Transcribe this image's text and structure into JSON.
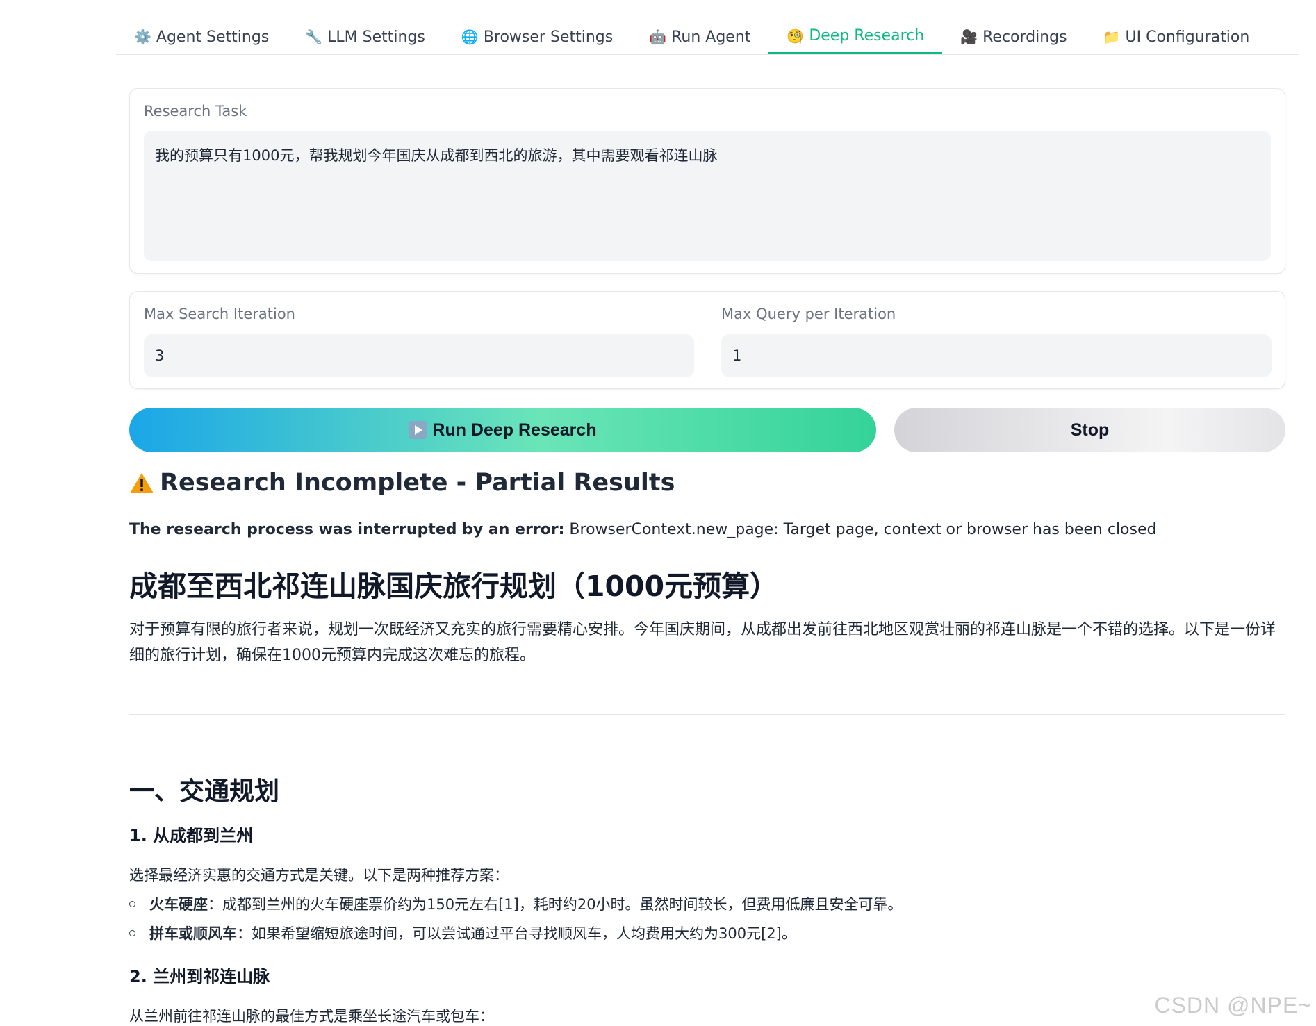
{
  "tabs": [
    {
      "icon": "⚙️",
      "label": "Agent Settings"
    },
    {
      "icon": "🔧",
      "label": "LLM Settings"
    },
    {
      "icon": "🌐",
      "label": "Browser Settings"
    },
    {
      "icon": "🤖",
      "label": "Run Agent"
    },
    {
      "icon": "🧐",
      "label": "Deep Research"
    },
    {
      "icon": "🎥",
      "label": "Recordings"
    },
    {
      "icon": "📁",
      "label": "UI Configuration"
    }
  ],
  "active_tab": "Deep Research",
  "task": {
    "label": "Research Task",
    "value": "我的预算只有1000元，帮我规划今年国庆从成都到西北的旅游，其中需要观看祁连山脉"
  },
  "iterations": {
    "max_search_label": "Max Search Iteration",
    "max_search_value": "3",
    "max_query_label": "Max Query per Iteration",
    "max_query_value": "1"
  },
  "buttons": {
    "run_label": "Run Deep Research",
    "stop_label": "Stop"
  },
  "result": {
    "warning_title": "Research Incomplete - Partial Results",
    "error_prefix": "The research process was interrupted by an error:",
    "error_message": " BrowserContext.new_page: Target page, context or browser has been closed",
    "title": "成都至西北祁连山脉国庆旅行规划（1000元预算）",
    "intro": "对于预算有限的旅行者来说，规划一次既经济又充实的旅行需要精心安排。今年国庆期间，从成都出发前往西北地区观赏壮丽的祁连山脉是一个不错的选择。以下是一份详细的旅行计划，确保在1000元预算内完成这次难忘的旅程。",
    "section1_title": "一、交通规划",
    "sub1_title": "1. 从成都到兰州",
    "sub1_intro": "选择最经济实惠的交通方式是关键。以下是两种推荐方案：",
    "sub1_items": [
      {
        "bold": "火车硬座",
        "text": "：成都到兰州的火车硬座票价约为150元左右[1]，耗时约20小时。虽然时间较长，但费用低廉且安全可靠。"
      },
      {
        "bold": "拼车或顺风车",
        "text": "：如果希望缩短旅途时间，可以尝试通过平台寻找顺风车，人均费用大约为300元[2]。"
      }
    ],
    "sub2_title": "2. 兰州到祁连山脉",
    "sub2_intro": "从兰州前往祁连山脉的最佳方式是乘坐长途汽车或包车："
  },
  "watermark": "CSDN @NPE~"
}
